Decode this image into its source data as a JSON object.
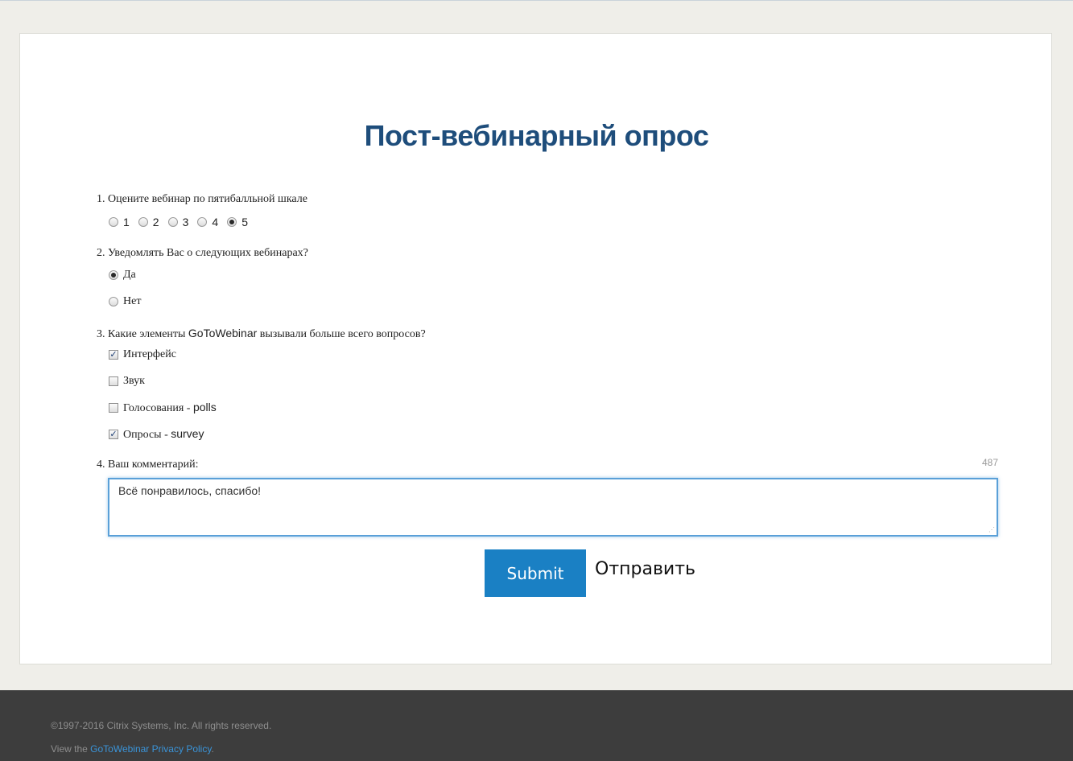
{
  "title": "Пост-вебинарный опрос",
  "questions": {
    "q1": {
      "label": "1. Оцените вебинар по пятибалльной шкале",
      "options": [
        "1",
        "2",
        "3",
        "4",
        "5"
      ],
      "selected": "5"
    },
    "q2": {
      "label": "2. Уведомлять Вас о следующих вебинарах?",
      "options": [
        "Да",
        "Нет"
      ],
      "selected": "Да"
    },
    "q3": {
      "label_prefix": "3. Какие элементы ",
      "label_brand": "GoToWebinar",
      "label_suffix": " вызывали больше всего вопросов?",
      "options": [
        {
          "label_a": "Интерфейс",
          "label_b": "",
          "checked": true
        },
        {
          "label_a": "Звук",
          "label_b": "",
          "checked": false
        },
        {
          "label_a": "Голосования - ",
          "label_b": "polls",
          "checked": false
        },
        {
          "label_a": "Опросы - ",
          "label_b": "survey",
          "checked": true
        }
      ]
    },
    "q4": {
      "label": "4. Ваш комментарий:",
      "remaining_chars": "487",
      "value": "Всё понравилось, спасибо!"
    }
  },
  "submit_label": "Submit",
  "submit_annotation": "Отправить",
  "footer": {
    "copyright": "©1997-2016 Citrix Systems, Inc. All rights reserved.",
    "privacy_prefix": "View the ",
    "privacy_link": "GoToWebinar Privacy Policy",
    "privacy_suffix": "."
  },
  "colors": {
    "title": "#1e4d7b",
    "button": "#1a80c4",
    "footer_bg": "#3d3d3d",
    "link": "#3a94d9"
  }
}
